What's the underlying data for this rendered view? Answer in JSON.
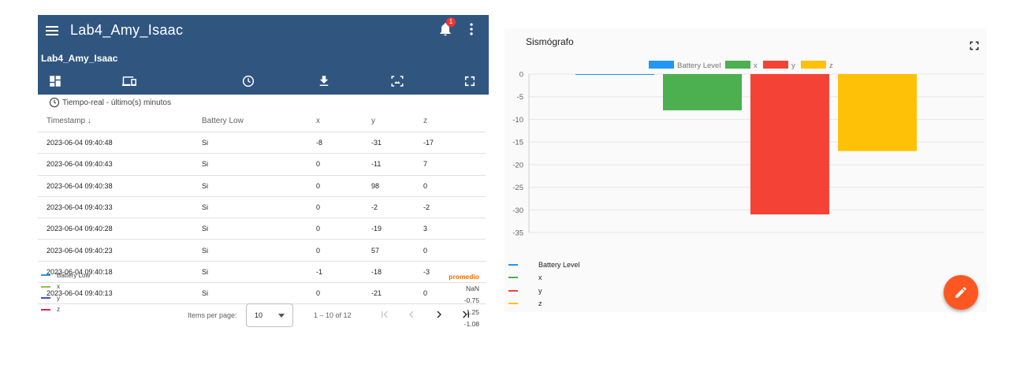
{
  "app": {
    "title": "Lab4_Amy_Isaac",
    "dashboard_title": "Lab4_Amy_Isaac",
    "notification_count": "1"
  },
  "toolbar_icons": [
    "dashboard-icon",
    "devices-icon",
    "history-icon",
    "download-icon",
    "image-icon",
    "fullscreen-icon"
  ],
  "table_widget": {
    "timewindow": "Tiempo-real - último(s) minutos",
    "headers": [
      "Timestamp",
      "Battery Low",
      "x",
      "y",
      "z"
    ],
    "rows": [
      [
        "2023-06-04 09:40:48",
        "Si",
        "-8",
        "-31",
        "-17"
      ],
      [
        "2023-06-04 09:40:43",
        "Si",
        "0",
        "-11",
        "7"
      ],
      [
        "2023-06-04 09:40:38",
        "Si",
        "0",
        "98",
        "0"
      ],
      [
        "2023-06-04 09:40:33",
        "Si",
        "0",
        "-2",
        "-2"
      ],
      [
        "2023-06-04 09:40:28",
        "Si",
        "0",
        "-19",
        "3"
      ],
      [
        "2023-06-04 09:40:23",
        "Si",
        "0",
        "57",
        "0"
      ],
      [
        "2023-06-04 09:40:18",
        "Si",
        "-1",
        "-18",
        "-3"
      ],
      [
        "2023-06-04 09:40:13",
        "Si",
        "0",
        "-21",
        "0"
      ]
    ],
    "legend_overlay": [
      {
        "label": "Battery Low",
        "color": "#2196f3"
      },
      {
        "label": "x",
        "color": "#8bc34a"
      },
      {
        "label": "y",
        "color": "#3f51b5"
      },
      {
        "label": "z",
        "color": "#e91e63"
      }
    ],
    "promedio": {
      "header": "promedio",
      "values": [
        "NaN",
        "-0.75",
        "1.25",
        "-1.08"
      ]
    },
    "pagination": {
      "items_per_page_label": "Items per page:",
      "page_size": "10",
      "range": "1 – 10 of 12"
    }
  },
  "chart_widget": {
    "title": "Sismógrafo",
    "bottom_legend": [
      {
        "label": "Battery Level",
        "color": "#2196f3"
      },
      {
        "label": "x",
        "color": "#4caf50"
      },
      {
        "label": "y",
        "color": "#f44336"
      },
      {
        "label": "z",
        "color": "#ffc107"
      }
    ]
  },
  "chart_data": {
    "type": "bar",
    "title": "Sismógrafo",
    "categories": [
      ""
    ],
    "series": [
      {
        "name": "Battery Level",
        "values": [
          0
        ],
        "color": "#2196f3"
      },
      {
        "name": "x",
        "values": [
          -8
        ],
        "color": "#4caf50"
      },
      {
        "name": "y",
        "values": [
          -31
        ],
        "color": "#f44336"
      },
      {
        "name": "z",
        "values": [
          -17
        ],
        "color": "#ffc107"
      }
    ],
    "yticks": [
      "0",
      "-5",
      "-10",
      "-15",
      "-20",
      "-25",
      "-30",
      "-35"
    ],
    "ylim": [
      -35,
      0
    ],
    "grid": true,
    "legend_position": "top"
  }
}
